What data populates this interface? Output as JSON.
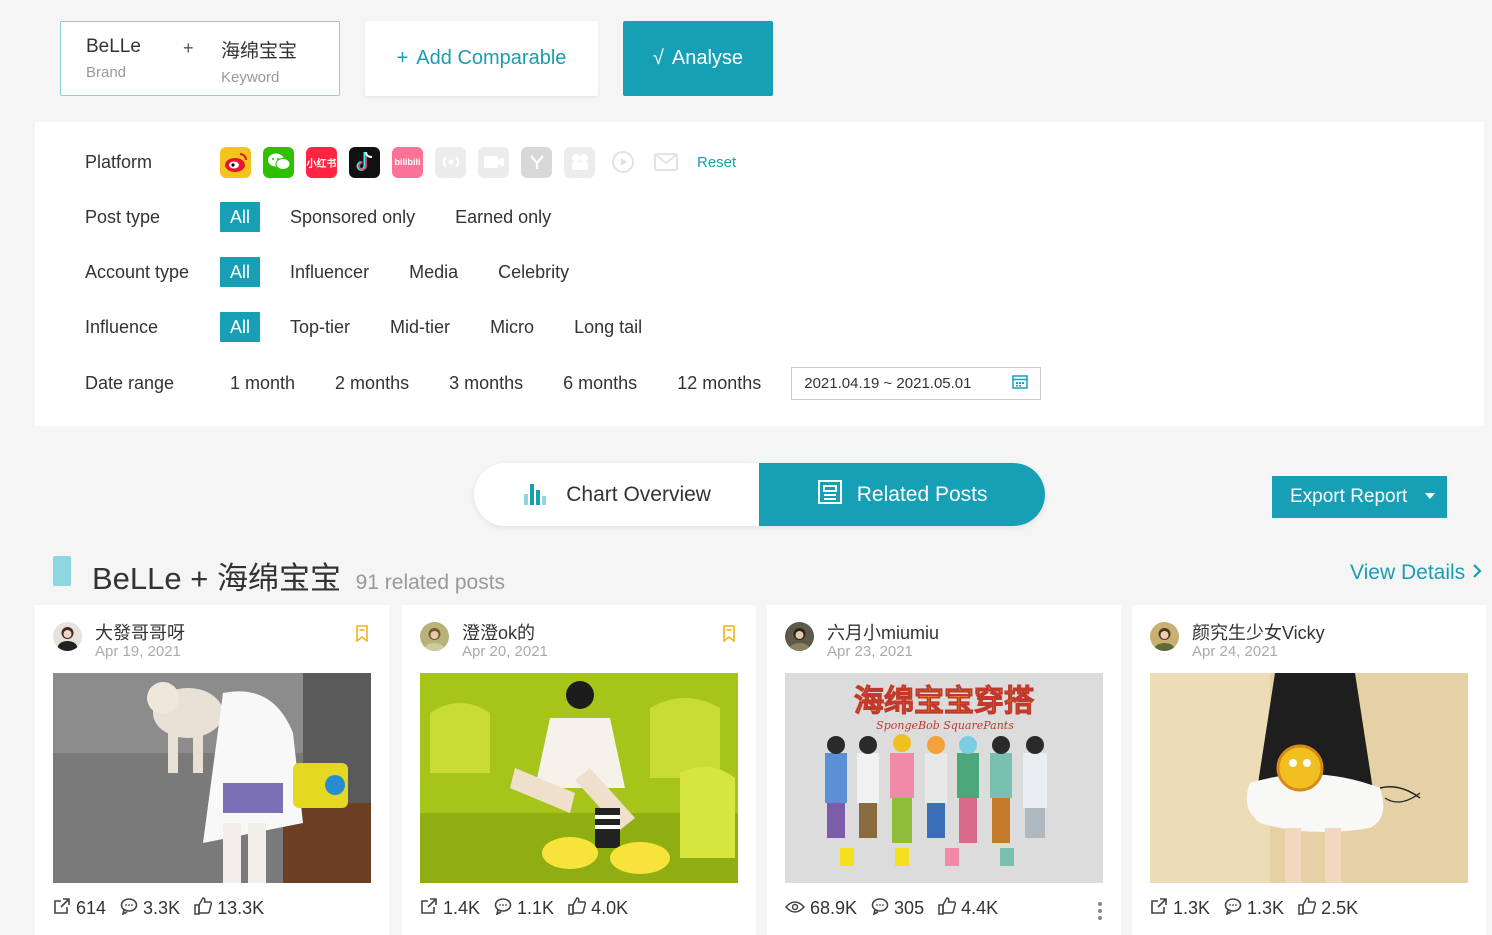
{
  "query": {
    "brand": "BeLLe",
    "brand_label": "Brand",
    "plus": "+",
    "keyword": "海绵宝宝",
    "keyword_label": "Keyword"
  },
  "actions": {
    "add_comparable": "Add Comparable",
    "add_icon": "+",
    "analyse": "Analyse",
    "analyse_icon": "√"
  },
  "filters": {
    "platform_label": "Platform",
    "platforms": [
      {
        "name": "weibo-icon",
        "active": true
      },
      {
        "name": "wechat-icon",
        "active": true
      },
      {
        "name": "xiaohongshu-icon",
        "active": true
      },
      {
        "name": "douyin-icon",
        "active": true
      },
      {
        "name": "bilibili-icon",
        "active": true
      },
      {
        "name": "broadcast-icon",
        "active": false
      },
      {
        "name": "video-icon",
        "active": false
      },
      {
        "name": "y-icon",
        "active": false
      },
      {
        "name": "film-icon",
        "active": false
      },
      {
        "name": "play-icon",
        "active": false
      },
      {
        "name": "mail-icon",
        "active": false
      }
    ],
    "xiaohongshu_text": "小红书",
    "bilibili_text": "bilibili",
    "reset": "Reset",
    "post_type_label": "Post type",
    "post_type": [
      "All",
      "Sponsored only",
      "Earned only"
    ],
    "account_type_label": "Account type",
    "account_type": [
      "All",
      "Influencer",
      "Media",
      "Celebrity"
    ],
    "influence_label": "Influence",
    "influence": [
      "All",
      "Top-tier",
      "Mid-tier",
      "Micro",
      "Long tail"
    ],
    "date_range_label": "Date range",
    "date_range": [
      "1 month",
      "2 months",
      "3 months",
      "6 months",
      "12 months"
    ],
    "date_value": "2021.04.19 ~ 2021.05.01"
  },
  "tabs": {
    "chart_overview": "Chart Overview",
    "related_posts": "Related Posts"
  },
  "export": "Export Report",
  "section": {
    "title": "BeLLe + 海绵宝宝",
    "count": "91 related posts",
    "view_details": "View Details"
  },
  "colors": {
    "accent": "#17a0b5",
    "marker": "#8fd7e0",
    "bookmark": "#f2b21c"
  },
  "posts": [
    {
      "author": "大發哥哥呀",
      "date": "Apr 19, 2021",
      "stat1_icon": "share-icon",
      "stat1": "614",
      "comments": "3.3K",
      "likes": "13.3K",
      "bookmark": true,
      "more": false
    },
    {
      "author": "澄澄ok的",
      "date": "Apr 20, 2021",
      "stat1_icon": "share-icon",
      "stat1": "1.4K",
      "comments": "1.1K",
      "likes": "4.0K",
      "bookmark": true,
      "more": false
    },
    {
      "author": "六月小miumiu",
      "date": "Apr 23, 2021",
      "stat1_icon": "views-icon",
      "stat1": "68.9K",
      "comments": "305",
      "likes": "4.4K",
      "bookmark": false,
      "more": true,
      "image_title": "海绵宝宝穿搭",
      "image_subtitle": "SpongeBob SquarePants"
    },
    {
      "author": "颜究生少女Vicky",
      "date": "Apr 24, 2021",
      "stat1_icon": "share-icon",
      "stat1": "1.3K",
      "comments": "1.3K",
      "likes": "2.5K",
      "bookmark": false,
      "more": false
    }
  ]
}
